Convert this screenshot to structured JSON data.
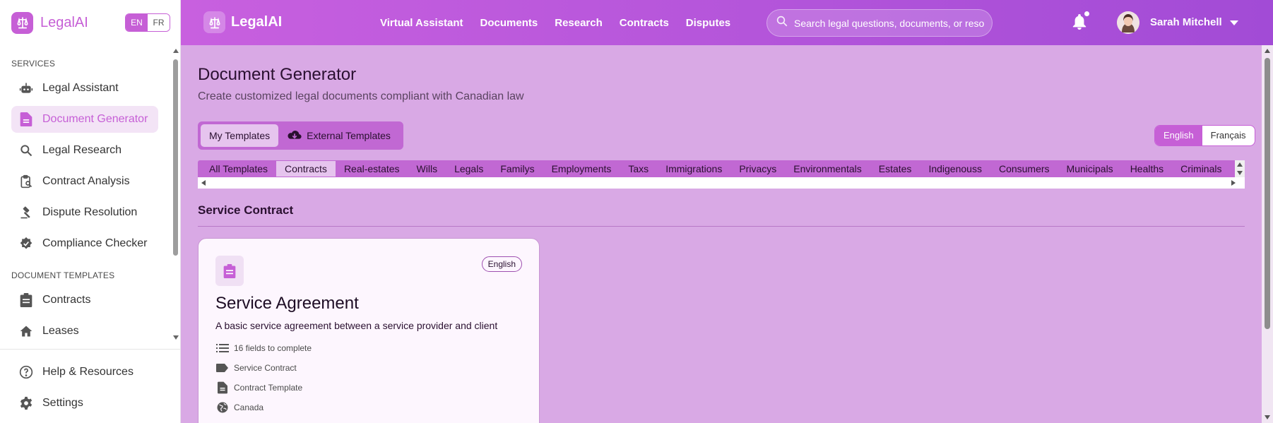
{
  "brand": {
    "name": "LegalAI"
  },
  "sidebar": {
    "lang": {
      "en": "EN",
      "fr": "FR"
    },
    "services_heading": "SERVICES",
    "services": [
      {
        "label": "Legal Assistant",
        "icon": "robot-icon"
      },
      {
        "label": "Document Generator",
        "icon": "document-icon",
        "active": true
      },
      {
        "label": "Legal Research",
        "icon": "search-icon"
      },
      {
        "label": "Contract Analysis",
        "icon": "clipboard-search-icon"
      },
      {
        "label": "Dispute Resolution",
        "icon": "gavel-icon"
      },
      {
        "label": "Compliance Checker",
        "icon": "verified-badge-icon"
      }
    ],
    "templates_heading": "DOCUMENT TEMPLATES",
    "templates": [
      {
        "label": "Contracts",
        "icon": "clipboard-icon"
      },
      {
        "label": "Leases",
        "icon": "home-icon"
      }
    ],
    "bottom": [
      {
        "label": "Help & Resources",
        "icon": "help-icon"
      },
      {
        "label": "Settings",
        "icon": "gear-icon"
      }
    ]
  },
  "topbar": {
    "nav": [
      "Virtual Assistant",
      "Documents",
      "Research",
      "Contracts",
      "Disputes"
    ],
    "search_placeholder": "Search legal questions, documents, or reso",
    "user_name": "Sarah Mitchell"
  },
  "page": {
    "title": "Document Generator",
    "subtitle": "Create customized legal documents compliant with Canadian law",
    "template_toggle": {
      "mine": "My Templates",
      "external": "External Templates"
    },
    "language": {
      "english": "English",
      "french": "Français",
      "selected": "English"
    },
    "tabs": [
      "All Templates",
      "Contracts",
      "Real-estates",
      "Wills",
      "Legals",
      "Familys",
      "Employments",
      "Taxs",
      "Immigrations",
      "Privacys",
      "Environmentals",
      "Estates",
      "Indigenouss",
      "Consumers",
      "Municipals",
      "Healths",
      "Criminals"
    ],
    "active_tab": "Contracts",
    "section_title": "Service Contract",
    "card": {
      "badge": "English",
      "title": "Service Agreement",
      "description": "A basic service agreement between a service provider and client",
      "meta": [
        {
          "icon": "list-icon",
          "text": "16 fields to complete"
        },
        {
          "icon": "tag-icon",
          "text": "Service Contract"
        },
        {
          "icon": "file-icon",
          "text": "Contract Template"
        },
        {
          "icon": "globe-icon",
          "text": "Canada"
        }
      ]
    }
  },
  "colors": {
    "accent": "#c65fd6",
    "background": "#d9a9e5",
    "topbar_start": "#c860df",
    "topbar_end": "#a24bd6"
  }
}
